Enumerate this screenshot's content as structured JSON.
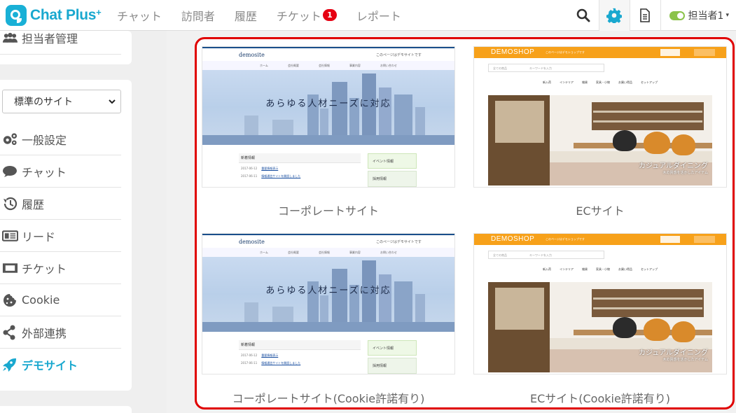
{
  "app": {
    "logo_text": "Chat Plus",
    "logo_plus": "+"
  },
  "nav": [
    {
      "label": "チャット"
    },
    {
      "label": "訪問者"
    },
    {
      "label": "履歴"
    },
    {
      "label": "チケット",
      "badge": "1"
    },
    {
      "label": "レポート"
    }
  ],
  "header_right": {
    "user": "担当者1",
    "caret": "▾"
  },
  "sidebar": {
    "top_item": "担当者管理",
    "site_select": {
      "value": "標準のサイト"
    },
    "items": [
      {
        "label": "一般設定",
        "icon": "gears-icon"
      },
      {
        "label": "チャット",
        "icon": "chat-bubble-icon"
      },
      {
        "label": "履歴",
        "icon": "history-icon"
      },
      {
        "label": "リード",
        "icon": "id-card-icon"
      },
      {
        "label": "チケット",
        "icon": "ticket-icon"
      },
      {
        "label": "Cookie",
        "icon": "cookie-icon"
      },
      {
        "label": "外部連携",
        "icon": "share-icon"
      },
      {
        "label": "デモサイト",
        "icon": "rocket-icon",
        "active": true
      }
    ]
  },
  "demo_sites": [
    {
      "title": "コーポレートサイト"
    },
    {
      "title": "ECサイト"
    },
    {
      "title": "コーポレートサイト(Cookie許諾有り)"
    },
    {
      "title": "ECサイト(Cookie許諾有り)"
    }
  ],
  "corporate_thumb": {
    "logo": "demosite",
    "tagline": "このページはデモサイトです",
    "menu": [
      "ホーム",
      "会社概要",
      "会社情報",
      "事業内容",
      "お問い合わせ"
    ],
    "hero_text": "あらゆる人材ニーズに対応",
    "news_heading": "新着情報",
    "news_rows": [
      {
        "date": "2017-06-12",
        "text": "重要情報表示"
      },
      {
        "date": "2017-06-11",
        "text": "情報通信サイトを開設しました"
      }
    ],
    "side_box1": "イベント情報",
    "side_box2": "採用情報"
  },
  "ec_thumb": {
    "logo": "DEMOSHOP",
    "tagline": "このページはデモショップです",
    "search_category": "全ての商品",
    "search_placeholder": "キーワードを入力",
    "categories": [
      "新入荷",
      "インテリア",
      "雑貨",
      "家具・小物",
      "お買い得品",
      "セットアップ"
    ],
    "caption_main": "カジュアルダイニング",
    "caption_sub": "木の質感を活かしたアイテム"
  },
  "colors": {
    "brand": "#19a8cf",
    "highlight": "#e00000",
    "ec_orange": "#f7a11a",
    "toggle_on": "#8bc34a",
    "badge": "#e60012"
  }
}
